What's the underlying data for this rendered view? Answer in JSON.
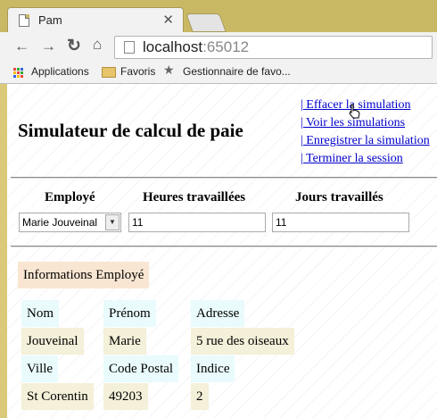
{
  "browser": {
    "tab_title": "Pam",
    "url_host": "localhost",
    "url_port": ":65012",
    "bookmarks": [
      "Applications",
      "Favoris",
      "Gestionnaire de favo..."
    ]
  },
  "page": {
    "title": "Simulateur de calcul de paie",
    "links": [
      "| Effacer la simulation",
      "| Voir les simulations",
      "| Enregistrer la simulation",
      "| Terminer la session"
    ],
    "form": {
      "employee_header": "Employé",
      "hours_header": "Heures travaillées",
      "days_header": "Jours travaillés",
      "employee_selected": "Marie Jouveinal",
      "hours_value": "11",
      "days_value": "11"
    },
    "info": {
      "heading": "Informations Employé",
      "nom_label": "Nom",
      "prenom_label": "Prénom",
      "adresse_label": "Adresse",
      "nom": "Jouveinal",
      "prenom": "Marie",
      "adresse": "5 rue des oiseaux",
      "ville_label": "Ville",
      "cp_label": "Code Postal",
      "indice_label": "Indice",
      "ville": "St Corentin",
      "cp": "49203",
      "indice": "2"
    }
  }
}
